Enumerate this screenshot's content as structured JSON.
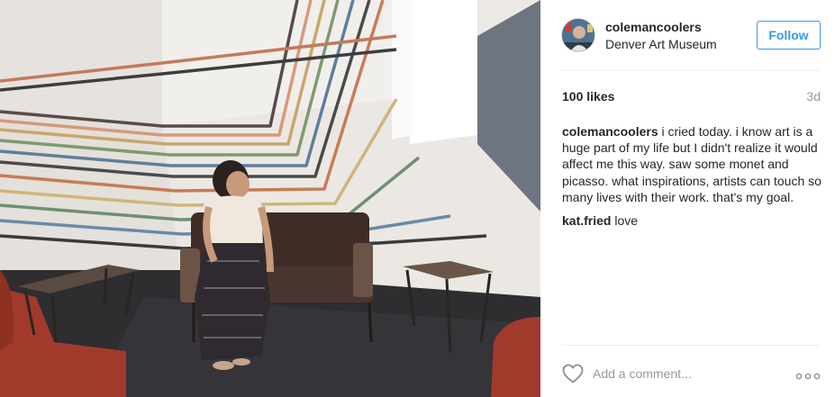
{
  "post": {
    "username": "colemancoolers",
    "location": "Denver Art Museum",
    "follow_label": "Follow",
    "likes_text": "100 likes",
    "time_ago": "3d",
    "comments": [
      {
        "user": "colemancoolers",
        "text": "i cried today. i know art is a huge part of my life but I didn't realize it would affect me this way. saw some monet and picasso. what inspirations, artists can touch so many lives with their work. that's my goal."
      },
      {
        "user": "kat.fried",
        "text": "love"
      }
    ],
    "add_comment_placeholder": "Add a comment...",
    "icons": {
      "like": "heart-outline-icon",
      "more": "more-options-icon"
    },
    "colors": {
      "accent": "#3897f0",
      "text": "#262626",
      "muted": "#999999",
      "divider": "#efefef"
    }
  }
}
